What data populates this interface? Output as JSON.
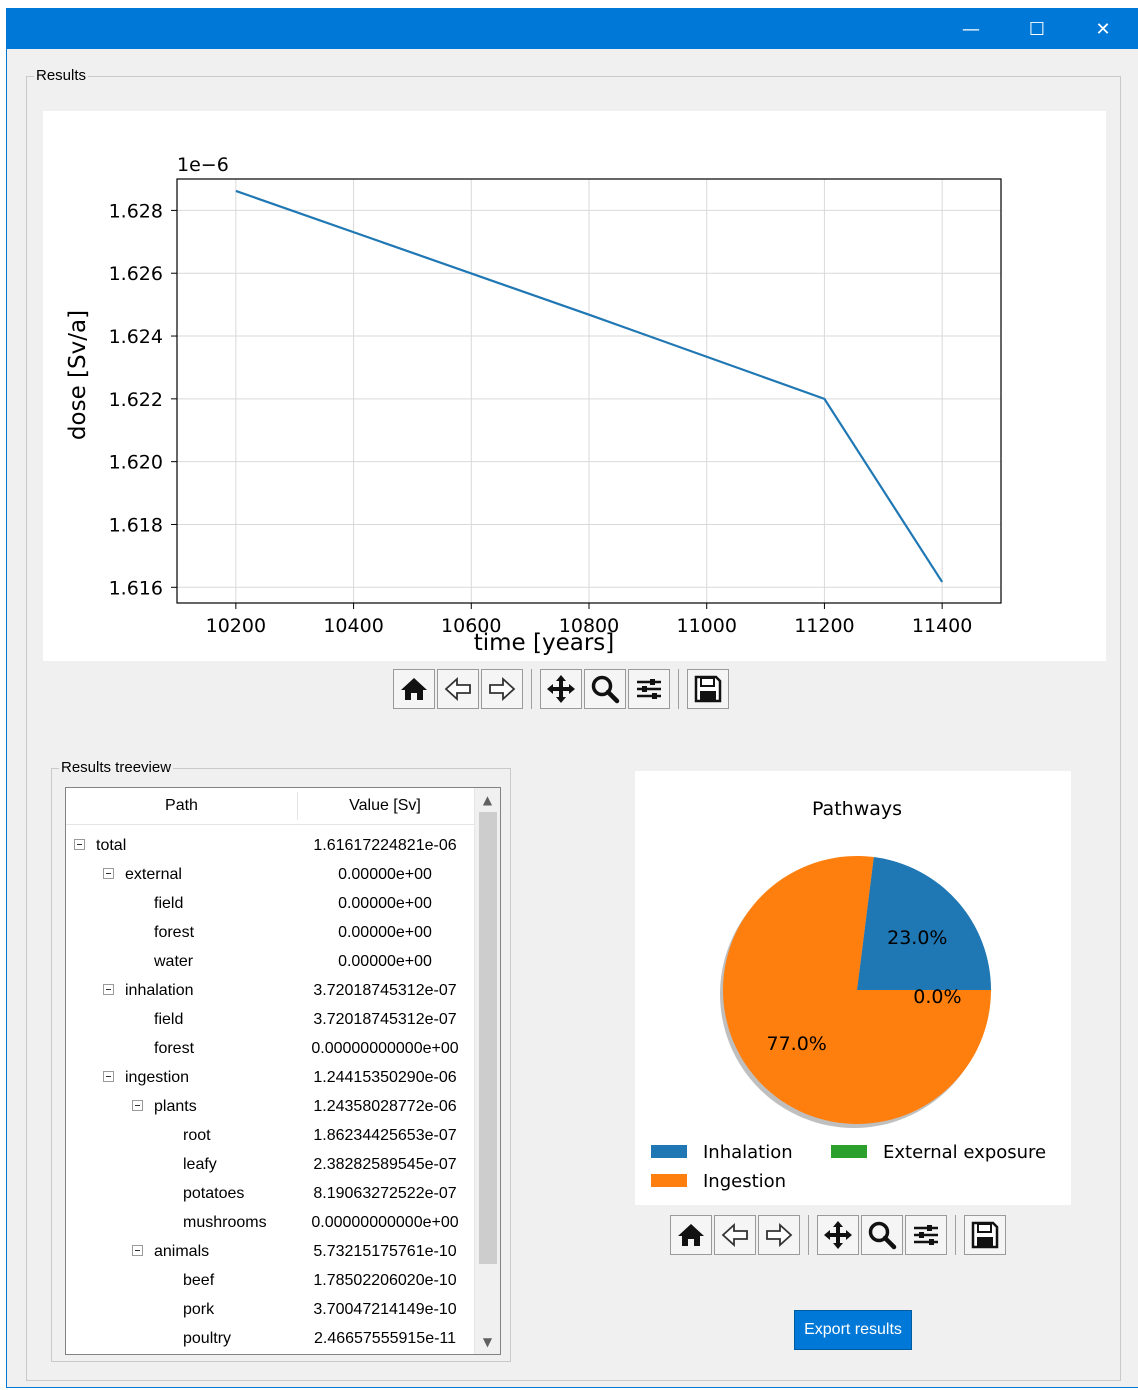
{
  "window": {
    "minimize_glyph": "—",
    "maximize_glyph": "☐",
    "close_glyph": "✕"
  },
  "results_group": {
    "label": "Results"
  },
  "treeview_group": {
    "label": "Results treeview"
  },
  "chart_data": [
    {
      "type": "line",
      "xlabel": "time [years]",
      "ylabel": "dose [Sv/a]",
      "y_offset_label": "1e−6",
      "x": [
        10200,
        10800,
        11200,
        11400
      ],
      "y": [
        1.62862,
        1.62468,
        1.622,
        1.61617
      ],
      "xlim": [
        10100,
        11500
      ],
      "ylim": [
        1.6155,
        1.629
      ],
      "xticks": [
        10200,
        10400,
        10600,
        10800,
        11000,
        11200,
        11400
      ],
      "xtick_labels": [
        "10200",
        "10400",
        "10600",
        "10800",
        "11000",
        "11200",
        "11400"
      ],
      "yticks": [
        1.616,
        1.618,
        1.62,
        1.622,
        1.624,
        1.626,
        1.628
      ],
      "ytick_labels": [
        "1.616",
        "1.618",
        "1.620",
        "1.622",
        "1.624",
        "1.626",
        "1.628"
      ],
      "grid": true,
      "series_color": "#1f77b4"
    },
    {
      "type": "pie",
      "title": "Pathways",
      "labels": [
        "Inhalation",
        "Ingestion",
        "External exposure"
      ],
      "values": [
        23.0,
        77.0,
        0.0
      ],
      "pct_labels": [
        "23.0%",
        "77.0%",
        "0.0%"
      ],
      "colors": [
        "#1f77b4",
        "#ff7f0e",
        "#2ca02c"
      ],
      "shadow": true,
      "legend": "below"
    }
  ],
  "toolbar_icons": [
    "home-icon",
    "back-arrow-icon",
    "forward-arrow-icon",
    "pan-icon",
    "zoom-icon",
    "configure-subplots-icon",
    "save-icon"
  ],
  "tree": {
    "columns": [
      "Path",
      "Value [Sv]"
    ],
    "rows": [
      {
        "label": "total",
        "value": "1.61617224821e-06",
        "level": 0,
        "expander": true
      },
      {
        "label": "external",
        "value": "0.00000e+00",
        "level": 1,
        "expander": true
      },
      {
        "label": "field",
        "value": "0.00000e+00",
        "level": 2,
        "expander": false
      },
      {
        "label": "forest",
        "value": "0.00000e+00",
        "level": 2,
        "expander": false
      },
      {
        "label": "water",
        "value": "0.00000e+00",
        "level": 2,
        "expander": false
      },
      {
        "label": "inhalation",
        "value": "3.72018745312e-07",
        "level": 1,
        "expander": true
      },
      {
        "label": "field",
        "value": "3.72018745312e-07",
        "level": 2,
        "expander": false
      },
      {
        "label": "forest",
        "value": "0.00000000000e+00",
        "level": 2,
        "expander": false
      },
      {
        "label": "ingestion",
        "value": "1.24415350290e-06",
        "level": 1,
        "expander": true
      },
      {
        "label": "plants",
        "value": "1.24358028772e-06",
        "level": 2,
        "expander": true
      },
      {
        "label": "root",
        "value": "1.86234425653e-07",
        "level": 3,
        "expander": false
      },
      {
        "label": "leafy",
        "value": "2.38282589545e-07",
        "level": 3,
        "expander": false
      },
      {
        "label": "potatoes",
        "value": "8.19063272522e-07",
        "level": 3,
        "expander": false
      },
      {
        "label": "mushrooms",
        "value": "0.00000000000e+00",
        "level": 3,
        "expander": false
      },
      {
        "label": "animals",
        "value": "5.73215175761e-10",
        "level": 2,
        "expander": true
      },
      {
        "label": "beef",
        "value": "1.78502206020e-10",
        "level": 3,
        "expander": false
      },
      {
        "label": "pork",
        "value": "3.70047214149e-10",
        "level": 3,
        "expander": false
      },
      {
        "label": "poultry",
        "value": "2.46657555915e-11",
        "level": 3,
        "expander": false
      }
    ]
  },
  "export_button": {
    "label": "Export results"
  }
}
